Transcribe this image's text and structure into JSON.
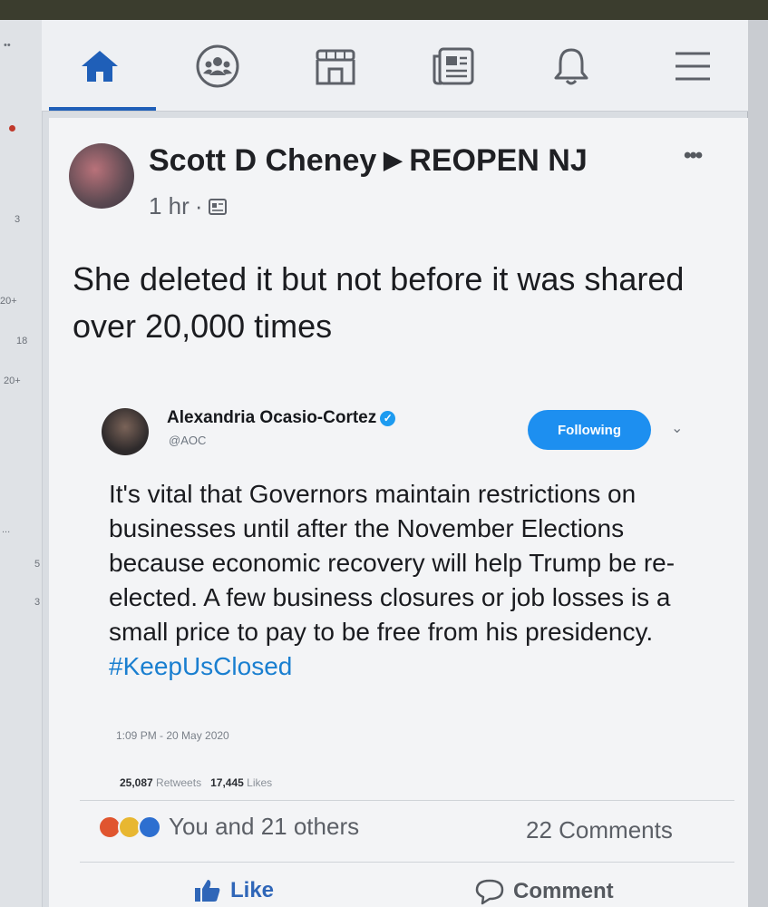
{
  "sidebar": {
    "counts": [
      "3",
      "20+",
      "18",
      "20+",
      "...",
      "5",
      "3"
    ]
  },
  "nav": {
    "items": [
      {
        "name": "home",
        "icon": "home-icon"
      },
      {
        "name": "groups",
        "icon": "groups-icon"
      },
      {
        "name": "marketplace",
        "icon": "marketplace-icon"
      },
      {
        "name": "news",
        "icon": "news-icon"
      },
      {
        "name": "notifications",
        "icon": "bell-icon"
      },
      {
        "name": "menu",
        "icon": "hamburger-icon"
      }
    ],
    "active": "home",
    "accent": "#1f5fb8"
  },
  "post": {
    "author": "Scott D Cheney",
    "group": "REOPEN NJ",
    "time": "1 hr",
    "separator": "·",
    "more": "•••",
    "text": "She deleted it but not before it was shared over 20,000 times",
    "tweet": {
      "name": "Alexandria Ocasio-Cortez",
      "verified": "✓",
      "handle": "@AOC",
      "follow_label": "Following",
      "chevron": "⌄",
      "text_main": "It's vital that Governors maintain restrictions on businesses until after the November Elections because economic recovery will help Trump be re-elected. A few business closures or job losses is a small price to pay to be free from his presidency.",
      "hashtag": "#KeepUsClosed",
      "timestamp": "1:09 PM - 20 May 2020",
      "retweets": "25,087",
      "retweets_label": "Retweets",
      "likes": "17,445",
      "likes_label": "Likes"
    },
    "reactions_text": "You and 21 others",
    "comments": "22 Comments",
    "actions": {
      "like": "Like",
      "comment": "Comment"
    }
  },
  "colors": {
    "like_blue": "#2f66b8",
    "twitter_blue": "#1d8ff0",
    "hashtag": "#1a7fd0"
  }
}
